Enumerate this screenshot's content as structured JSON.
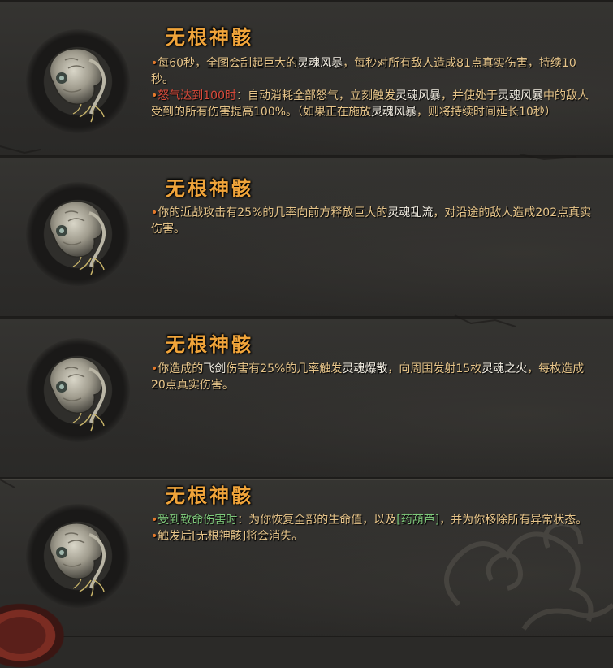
{
  "items": [
    {
      "title": "无根神骸",
      "lines": [
        [
          {
            "t": "•",
            "c": "bullet"
          },
          {
            "t": "每60秒，全图会刮起巨大的",
            "c": ""
          },
          {
            "t": "灵魂风暴",
            "c": "hl-white"
          },
          {
            "t": "，每秒对所有敌人造成81点真实伤害，持续10秒。",
            "c": ""
          }
        ],
        [
          {
            "t": "•",
            "c": "bullet"
          },
          {
            "t": "怒气达到100时",
            "c": "hl-red"
          },
          {
            "t": "：自动消耗全部怒气，立刻触发",
            "c": ""
          },
          {
            "t": "灵魂风暴",
            "c": "hl-white"
          },
          {
            "t": "，并使处于",
            "c": ""
          },
          {
            "t": "灵魂风暴",
            "c": "hl-white"
          },
          {
            "t": "中的敌人受到的所有伤害提高100%。（如果正在施放",
            "c": ""
          },
          {
            "t": "灵魂风暴",
            "c": "hl-white"
          },
          {
            "t": "，则将持续时间延长10秒）",
            "c": ""
          }
        ]
      ]
    },
    {
      "title": "无根神骸",
      "lines": [
        [
          {
            "t": "•",
            "c": "bullet"
          },
          {
            "t": "你的近战攻击有25%的几率向前方释放巨大的",
            "c": ""
          },
          {
            "t": "灵魂乱流",
            "c": "hl-white"
          },
          {
            "t": "，对沿途的敌人造成202点真实伤害。",
            "c": ""
          }
        ]
      ]
    },
    {
      "title": "无根神骸",
      "lines": [
        [
          {
            "t": "•",
            "c": "bullet"
          },
          {
            "t": "你造成的",
            "c": ""
          },
          {
            "t": "飞剑",
            "c": "hl-white"
          },
          {
            "t": "伤害有25%的几率触发",
            "c": ""
          },
          {
            "t": "灵魂爆散",
            "c": "hl-white"
          },
          {
            "t": "，向周围发射15枚",
            "c": ""
          },
          {
            "t": "灵魂之火",
            "c": "hl-white"
          },
          {
            "t": "，每枚造成20点真实伤害。",
            "c": ""
          }
        ]
      ]
    },
    {
      "title": "无根神骸",
      "lines": [
        [
          {
            "t": "•",
            "c": "bullet"
          },
          {
            "t": "受到致命伤害时",
            "c": "hl-green"
          },
          {
            "t": "：为你恢复全部的生命值，以及",
            "c": ""
          },
          {
            "t": "[药葫芦]",
            "c": "hl-green"
          },
          {
            "t": "，并为你移除所有异常状态。",
            "c": ""
          }
        ],
        [
          {
            "t": "•",
            "c": "bullet"
          },
          {
            "t": "触发后[无根神骸]将会消失。",
            "c": ""
          }
        ]
      ]
    }
  ],
  "colors": {
    "title": "#f0a43a",
    "text": "#e6c489",
    "bullet": "#e47a2c",
    "red": "#d84a3a",
    "green": "#7ec97a",
    "white": "#f2ede2"
  },
  "icon": "withered-skull-relic-icon"
}
